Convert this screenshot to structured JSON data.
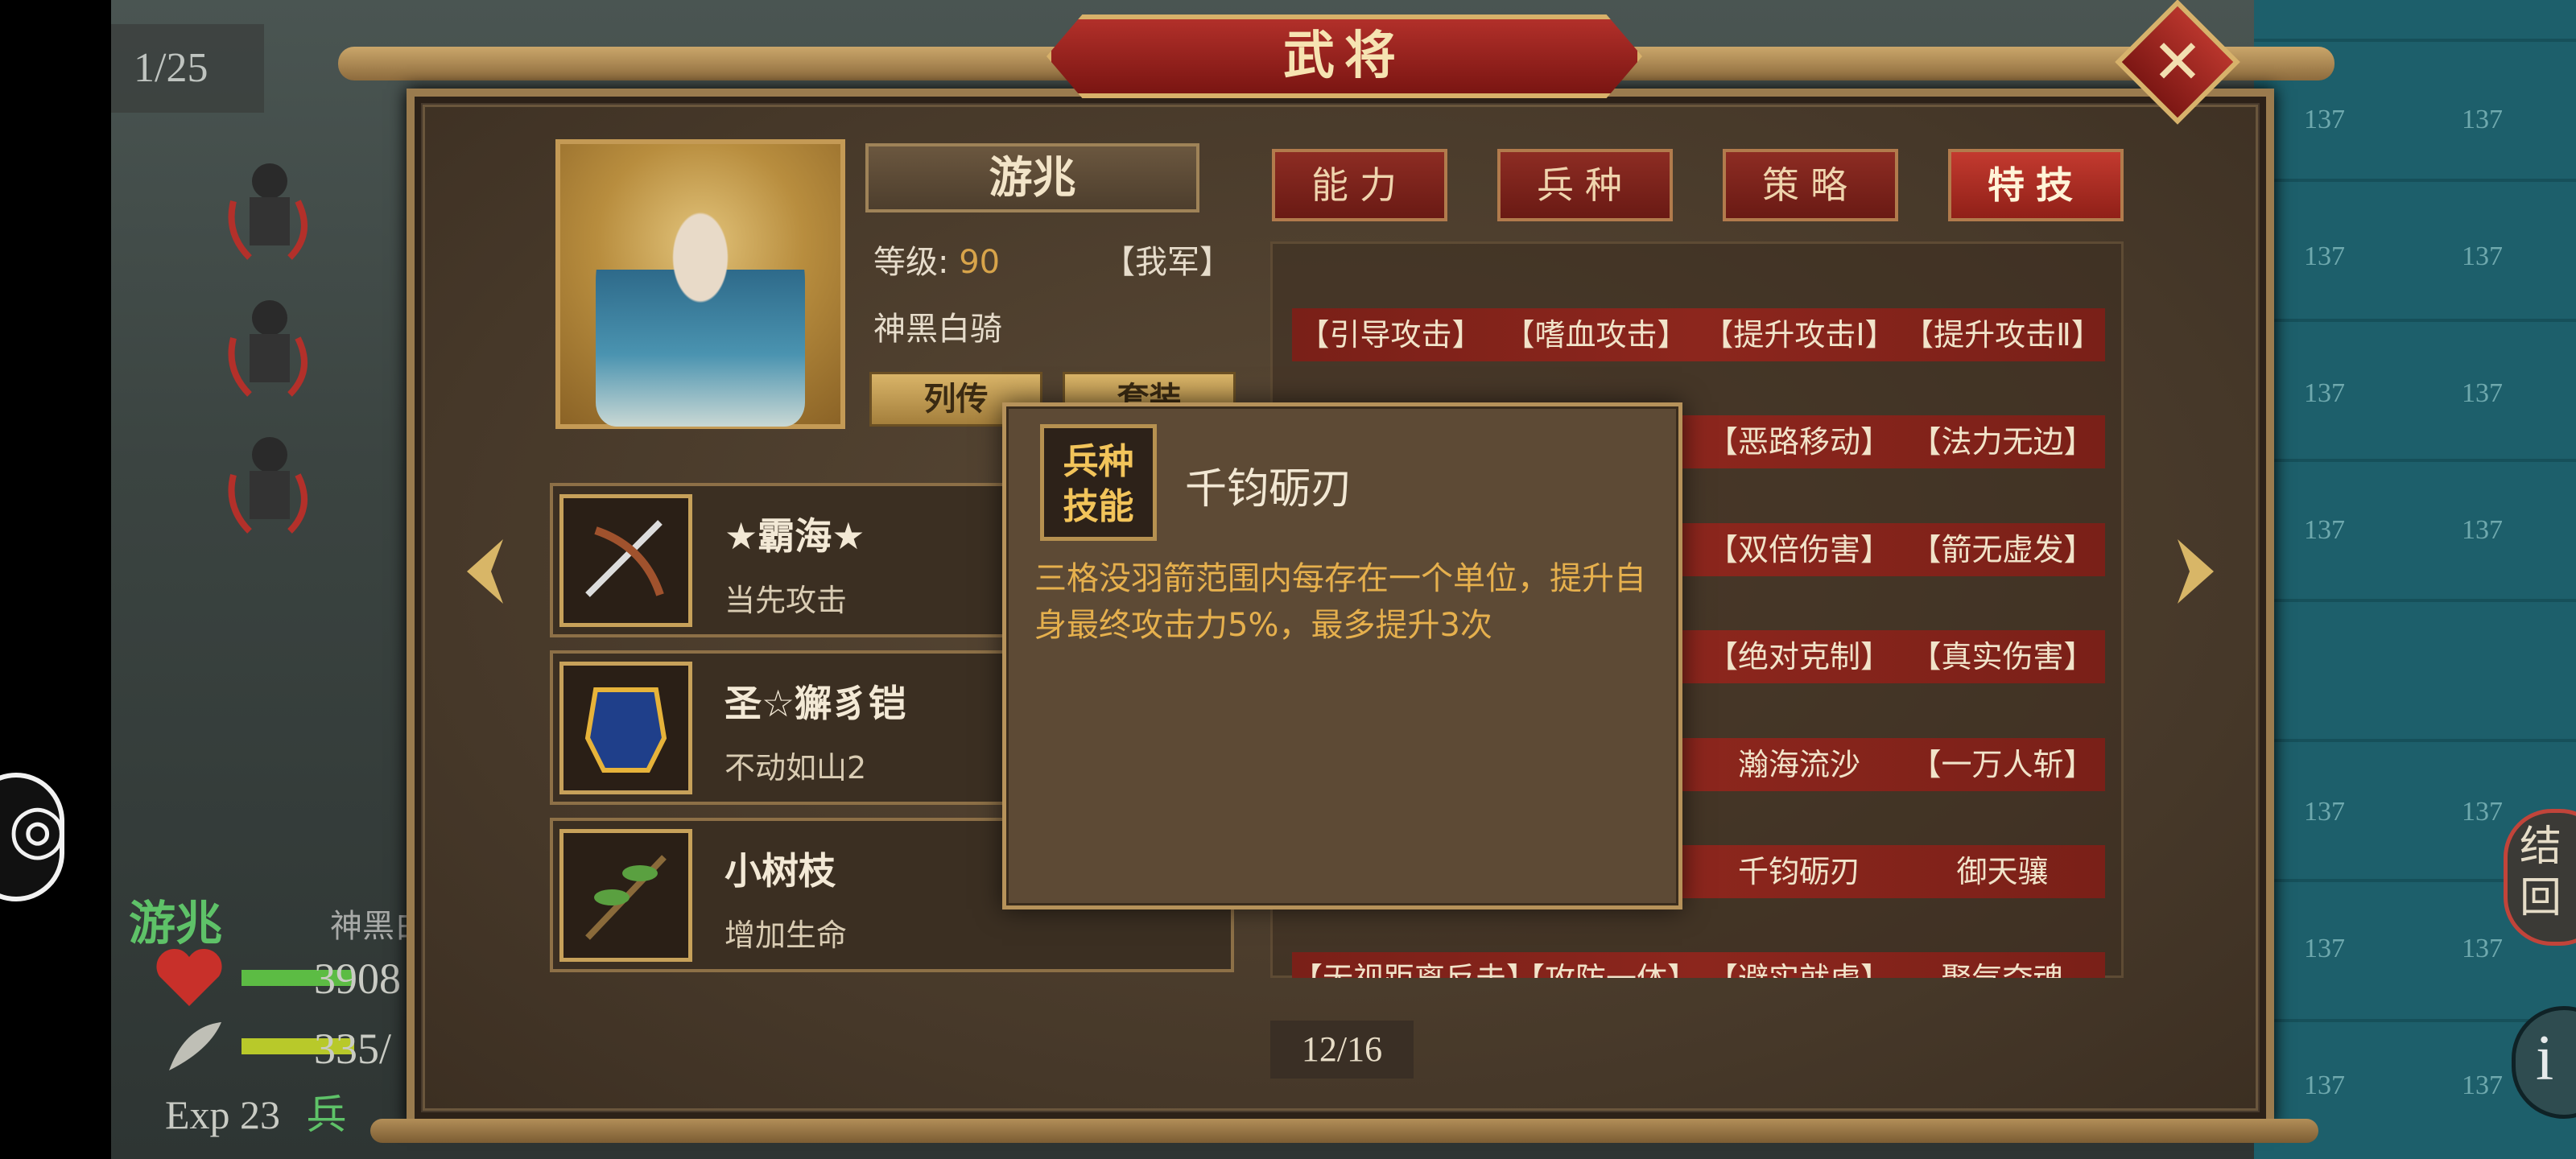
{
  "counter": "1/25",
  "title": "武将",
  "close_glyph": "✕",
  "hero": {
    "name": "游兆",
    "level_label": "等级:",
    "level_value": "90",
    "faction": "【我军】",
    "unit_type": "神黑白骑",
    "btn_bio": "列传",
    "btn_set": "套装"
  },
  "equipment": [
    {
      "name": "★霸海★",
      "desc": "当先攻击",
      "icon": "bow-icon"
    },
    {
      "name": "圣☆獬豸铠",
      "desc": "不动如山2",
      "icon": "armor-icon"
    },
    {
      "name": "小树枝",
      "desc": "增加生命",
      "icon": "branch-icon"
    }
  ],
  "tabs": [
    {
      "label": "能力",
      "active": false
    },
    {
      "label": "兵种",
      "active": false
    },
    {
      "label": "策略",
      "active": false
    },
    {
      "label": "特技",
      "active": true
    }
  ],
  "skills": [
    [
      "【引导攻击】",
      "【嗜血攻击】",
      "【提升攻击Ⅰ】",
      "【提升攻击Ⅱ】"
    ],
    [
      "",
      "",
      "【恶路移动】",
      "【法力无边】"
    ],
    [
      "",
      "",
      "【双倍伤害】",
      "【箭无虚发】"
    ],
    [
      "",
      "",
      "【绝对克制】",
      "【真实伤害】"
    ],
    [
      "",
      "",
      "瀚海流沙",
      "【一万人斩】"
    ],
    [
      "",
      "",
      "千钧砺刃",
      "御天骧"
    ],
    [
      "【无视距离反击】",
      "【攻防一体】",
      "【避实就虚】",
      "聚气夺魂"
    ]
  ],
  "tooltip": {
    "badge": "兵种技能",
    "badge_line1": "兵种",
    "badge_line2": "技能",
    "title": "千钧砺刃",
    "desc": "三格没羽箭范围内每存在一个单位，提升自身最终攻击力5%，最多提升3次"
  },
  "page": "12/16",
  "bg_info": {
    "name": "游兆",
    "type": "神黑白",
    "hp": "3908",
    "mp": "335/",
    "exp": "Exp 23",
    "exp_suffix": "兵"
  },
  "tile_number": "137",
  "side_btn_1": "结回",
  "side_btn_2": "i",
  "colors": {
    "accent_red": "#8d2c23",
    "gold": "#c49a55",
    "tooltip_text": "#e6b04d",
    "level": "#d8a44a"
  }
}
